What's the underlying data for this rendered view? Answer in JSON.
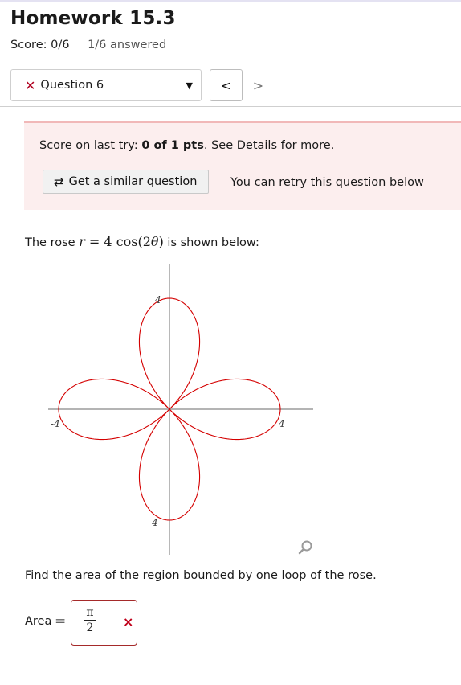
{
  "header": {
    "title": "Homework 15.3",
    "score": "Score: 0/6",
    "answered": "1/6 answered"
  },
  "question_nav": {
    "selected": "Question 6",
    "status_icon": "x-icon",
    "prev_icon": "<",
    "next_icon": ">"
  },
  "alert": {
    "prefix": "Score on last try: ",
    "score": "0 of 1 pts",
    "suffix": ". See Details for more.",
    "similar_button": "Get a similar question",
    "retry_text": "You can retry this question below",
    "background": "#fceeee"
  },
  "problem": {
    "prompt_before": "The rose ",
    "equation_var": "r",
    "equation_rhs": " = 4 cos(2",
    "equation_theta": "θ",
    "equation_close": ")",
    "prompt_after": " is shown below:",
    "graph": {
      "curve": "r = 4cos(2θ)",
      "color": "#d40000",
      "axis_limit": 4,
      "tick_labels": {
        "top": "4",
        "bottom": "-4",
        "left": "-4",
        "right": "4"
      }
    },
    "question": "Find the area of the region bounded by one loop of the rose.",
    "answer_label": "Area",
    "answer_equals": "=",
    "answer_numerator": "π",
    "answer_denominator": "2",
    "answer_status": "×"
  }
}
